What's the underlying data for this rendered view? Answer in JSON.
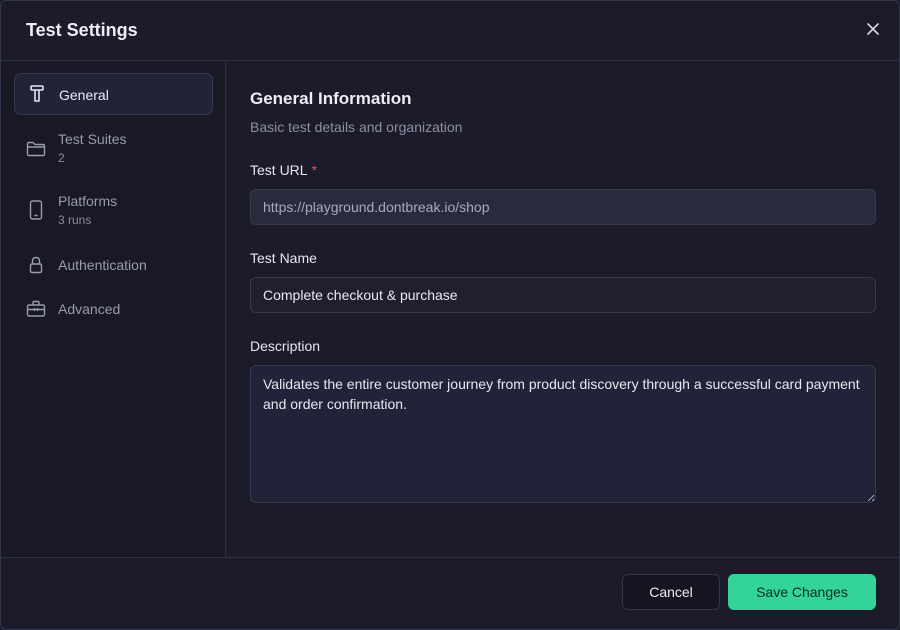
{
  "dialog": {
    "title": "Test Settings"
  },
  "sidebar": {
    "items": [
      {
        "label": "General",
        "sub": "",
        "icon": "hammer-icon",
        "active": true
      },
      {
        "label": "Test Suites",
        "sub": "2",
        "icon": "folder-icon",
        "active": false
      },
      {
        "label": "Platforms",
        "sub": "3 runs",
        "icon": "phone-icon",
        "active": false
      },
      {
        "label": "Authentication",
        "sub": "",
        "icon": "lock-icon",
        "active": false
      },
      {
        "label": "Advanced",
        "sub": "",
        "icon": "toolbox-icon",
        "active": false
      }
    ]
  },
  "section": {
    "title": "General Information",
    "subtitle": "Basic test details and organization"
  },
  "form": {
    "url_label": "Test URL",
    "required_mark": "*",
    "url_value": "https://playground.dontbreak.io/shop",
    "name_label": "Test Name",
    "name_value": "Complete checkout & purchase",
    "description_label": "Description",
    "description_value": "Validates the entire customer journey from product discovery through a successful card payment and order confirmation."
  },
  "footer": {
    "cancel_label": "Cancel",
    "save_label": "Save Changes"
  },
  "colors": {
    "accent": "#34d399",
    "required": "#e0506a",
    "background": "#1b1b2a"
  }
}
